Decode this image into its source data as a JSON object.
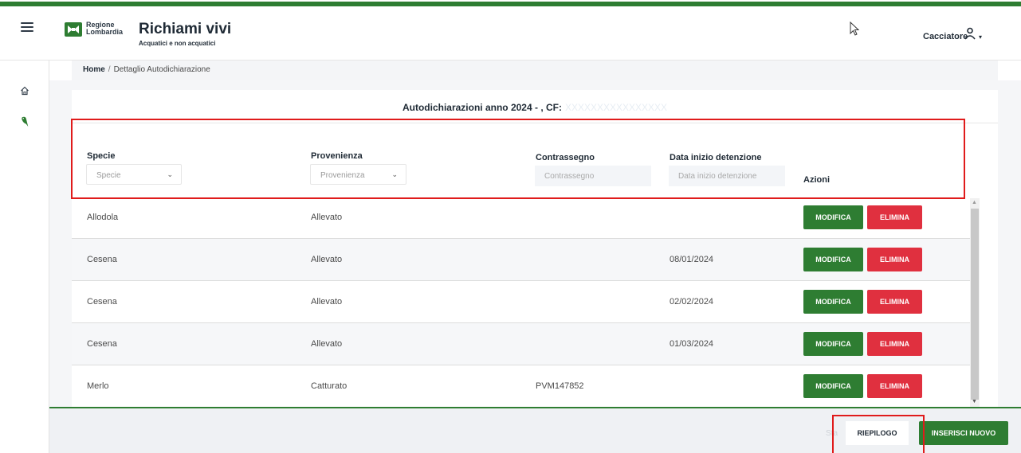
{
  "header": {
    "logo_line1": "Regione",
    "logo_line2": "Lombardia",
    "app_title": "Richiami vivi",
    "app_subtitle": "Acquatici e non acquatici",
    "user_role": "Cacciatore"
  },
  "sidebar": {
    "items": [
      {
        "icon": "home-icon"
      },
      {
        "icon": "bird-icon"
      }
    ]
  },
  "breadcrumb": {
    "home": "Home",
    "separator": "/",
    "current": "Dettaglio Autodichiarazione"
  },
  "card": {
    "title": "Autodichiarazioni anno 2024 - , CF:",
    "cf_value": "XXXXXXXXXXXXXXXX"
  },
  "filters": {
    "specie": {
      "label": "Specie",
      "placeholder": "Specie"
    },
    "provenienza": {
      "label": "Provenienza",
      "placeholder": "Provenienza"
    },
    "contrassegno": {
      "label": "Contrassegno",
      "placeholder": "Contrassegno"
    },
    "data_inizio": {
      "label": "Data inizio detenzione",
      "placeholder": "Data inizio detenzione"
    },
    "azioni": {
      "label": "Azioni"
    }
  },
  "actions": {
    "modify_label": "MODIFICA",
    "delete_label": "ELIMINA"
  },
  "rows": [
    {
      "specie": "Allodola",
      "provenienza": "Allevato",
      "contrassegno": "",
      "data": ""
    },
    {
      "specie": "Cesena",
      "provenienza": "Allevato",
      "contrassegno": "",
      "data": "08/01/2024"
    },
    {
      "specie": "Cesena",
      "provenienza": "Allevato",
      "contrassegno": "",
      "data": "02/02/2024"
    },
    {
      "specie": "Cesena",
      "provenienza": "Allevato",
      "contrassegno": "",
      "data": "01/03/2024"
    },
    {
      "specie": "Merlo",
      "provenienza": "Catturato",
      "contrassegno": "PVM147852",
      "data": ""
    }
  ],
  "footer": {
    "ghost_text": "Sta",
    "riepilogo_label": "RIEPILOGO",
    "inserisci_label": "INSERISCI NUOVO"
  },
  "colors": {
    "brand_green": "#2e7d32",
    "danger_red": "#e0303f",
    "highlight_red": "#e01b1b"
  }
}
